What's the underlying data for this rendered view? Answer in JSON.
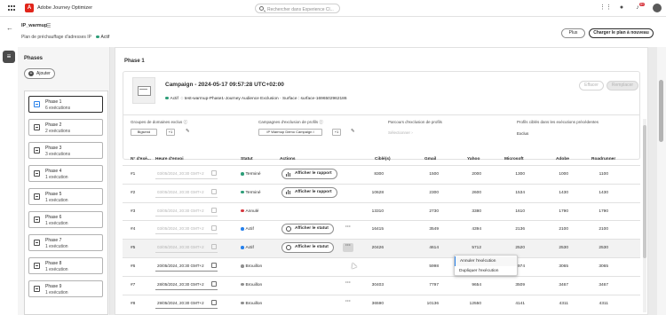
{
  "app": {
    "name": "Adobe Journey Optimizer",
    "search_placeholder": "Rechercher dans Experience Cl...",
    "notifications_count": "9+"
  },
  "plan": {
    "name": "IP_warmup",
    "subtitle": "Plan de préchauffage d'adresses IP",
    "status": "Actif",
    "status_color": "#2d9d78"
  },
  "header_buttons": {
    "more": "Plus",
    "new_plan": "Charger le plan à nouveau"
  },
  "phases_panel": {
    "title": "Phases",
    "add_label": "Ajouter",
    "items": [
      {
        "name": "Phase 1",
        "executions": "6 exécutions"
      },
      {
        "name": "Phase 2",
        "executions": "2 exécutions"
      },
      {
        "name": "Phase 3",
        "executions": "3 exécutions"
      },
      {
        "name": "Phase 4",
        "executions": "1 exécution"
      },
      {
        "name": "Phase 5",
        "executions": "1 exécution"
      },
      {
        "name": "Phase 6",
        "executions": "1 exécution"
      },
      {
        "name": "Phase 7",
        "executions": "1 exécution"
      },
      {
        "name": "Phase 8",
        "executions": "1 exécution"
      },
      {
        "name": "Phase 9",
        "executions": "1 exécution"
      }
    ]
  },
  "phase_detail": {
    "title": "Phase 1",
    "campaign": {
      "title": "Campaign - 2024-05-17 09:57:28 UTC+02:00",
      "status": "Actif",
      "journey": "test-warmup-Phase1-Journey Audience Exclusion",
      "surface": "Surface : surface-1696502962186",
      "delete_label": "Effacer",
      "replace_label": "Remplacer"
    },
    "columns": {
      "domain_groups": {
        "label": "Groupes de domaines exclus",
        "chip": "Bigsend",
        "count": "+1"
      },
      "campaign_exclusion": {
        "label": "Campagnes d'exclusion de profils",
        "chip": "IP Warmup Demo Campaign I",
        "count": "+1"
      },
      "journey_exclusion": {
        "label": "Parcours d'exclusion de profils",
        "value": "Sélectionner"
      },
      "profiles_targeted": {
        "label": "Profils ciblés dans les exécutions précédentes",
        "value": "Exclus"
      }
    }
  },
  "table": {
    "headers": [
      "N° d'exé...",
      "Heure d'envoi",
      "Statut",
      "Actions",
      "Ciblé(s)",
      "Gmail",
      "Yahoo",
      "Microsoft",
      "Adobe",
      "Roadrunner"
    ],
    "rows": [
      {
        "num": "#1",
        "date": "03/05/2024, 20:30 GMT+2",
        "status": "Terminé",
        "status_color": "#2d9d78",
        "action": "Afficher le rapport",
        "action_icon": "bar-chart-icon",
        "more": false,
        "values": [
          "8300",
          "1500",
          "2000",
          "1300",
          "1000",
          "1100"
        ]
      },
      {
        "num": "#2",
        "date": "03/05/2024, 20:30 GMT+2",
        "status": "Terminé",
        "status_color": "#2d9d78",
        "action": "Afficher le rapport",
        "action_icon": "bar-chart-icon",
        "more": false,
        "values": [
          "10628",
          "2300",
          "2600",
          "1534",
          "1430",
          "1430"
        ]
      },
      {
        "num": "#3",
        "date": "03/05/2024, 20:30 GMT+2",
        "status": "Annulé",
        "status_color": "#d7373f",
        "action": "",
        "action_icon": "",
        "more": false,
        "values": [
          "13310",
          "2730",
          "3380",
          "1610",
          "1790",
          "1790"
        ]
      },
      {
        "num": "#4",
        "date": "03/05/2024, 20:30 GMT+2",
        "status": "Actif",
        "status_color": "#2680eb",
        "action": "Afficher le statut",
        "action_icon": "clock-icon",
        "more": true,
        "values": [
          "16415",
          "3549",
          "4394",
          "2136",
          "2100",
          "2100"
        ]
      },
      {
        "num": "#5",
        "date": "03/05/2024, 20:30 GMT+2",
        "status": "Actif",
        "status_color": "#2680eb",
        "action": "Afficher le statut",
        "action_icon": "clock-icon",
        "more": true,
        "values": [
          "20426",
          "4614",
          "5712",
          "2520",
          "2530",
          "2530"
        ]
      },
      {
        "num": "#6",
        "date": "20/05/2024, 20:30 GMT+2",
        "status": "Brouillon",
        "status_color": "#8e8e8e",
        "action": "",
        "action_icon": "",
        "more": false,
        "values": [
          "",
          "5998",
          "7426",
          "2974",
          "3065",
          "3065"
        ]
      },
      {
        "num": "#7",
        "date": "28/05/2024, 20:30 GMT+2",
        "status": "Brouillon",
        "status_color": "#8e8e8e",
        "action": "",
        "action_icon": "",
        "more": true,
        "values": [
          "30403",
          "7797",
          "9654",
          "3509",
          "3467",
          "3467"
        ]
      },
      {
        "num": "#8",
        "date": "29/05/2024, 20:30 GMT+2",
        "status": "Brouillon",
        "status_color": "#8e8e8e",
        "action": "",
        "action_icon": "",
        "more": true,
        "values": [
          "36590",
          "10136",
          "12550",
          "4141",
          "4311",
          "4311"
        ]
      }
    ]
  },
  "context_menu": {
    "items": [
      "Annuler l'exécution",
      "Dupliquer l'exécution"
    ]
  }
}
